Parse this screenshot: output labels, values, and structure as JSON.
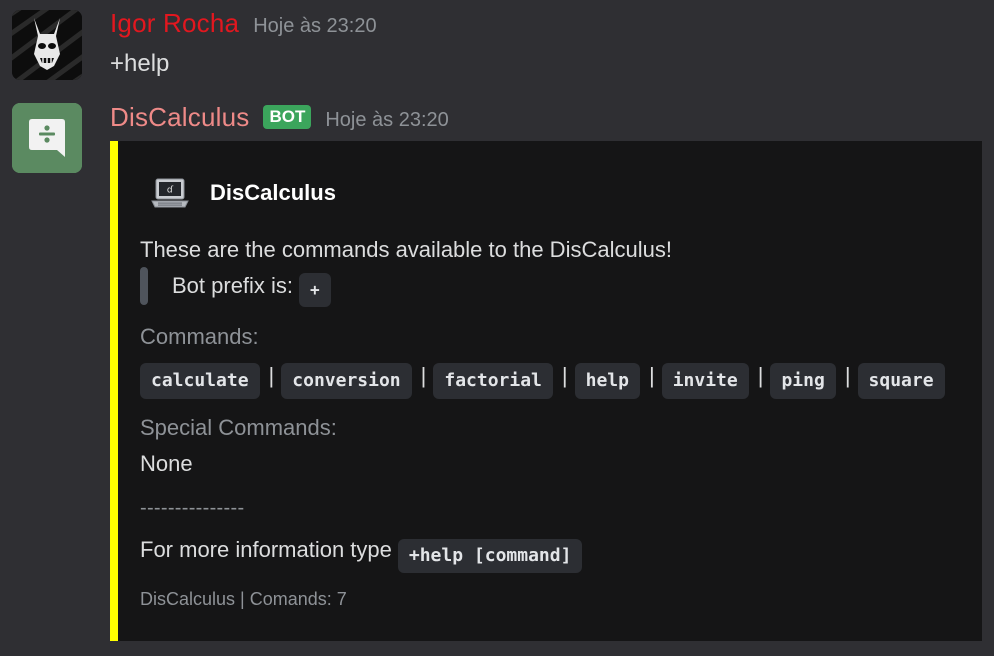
{
  "messages": {
    "user_message": {
      "username": "Igor Rocha",
      "timestamp": "Hoje às 23:20",
      "text": "+help",
      "name_color": "#e2171f"
    },
    "bot_message": {
      "username": "DisCalculus",
      "bot_tag": "BOT",
      "timestamp": "Hoje às 23:20",
      "name_color": "#ee8a88"
    }
  },
  "embed": {
    "accent_color": "#ffff00",
    "author_icon": "laptop-icon",
    "author": "DisCalculus",
    "description": "These are the commands available to the DisCalculus!",
    "quote_text": "Bot prefix is:",
    "prefix": "+",
    "commands_title": "Commands:",
    "commands": [
      "calculate",
      "conversion",
      "factorial",
      "help",
      "invite",
      "ping",
      "square"
    ],
    "separator": "|",
    "special_title": "Special Commands:",
    "special_value": "None",
    "dashes": "---------------",
    "more_info_label": "For more information type",
    "more_info_code": "+help [command]",
    "footer": "DisCalculus | Comands: 7"
  }
}
